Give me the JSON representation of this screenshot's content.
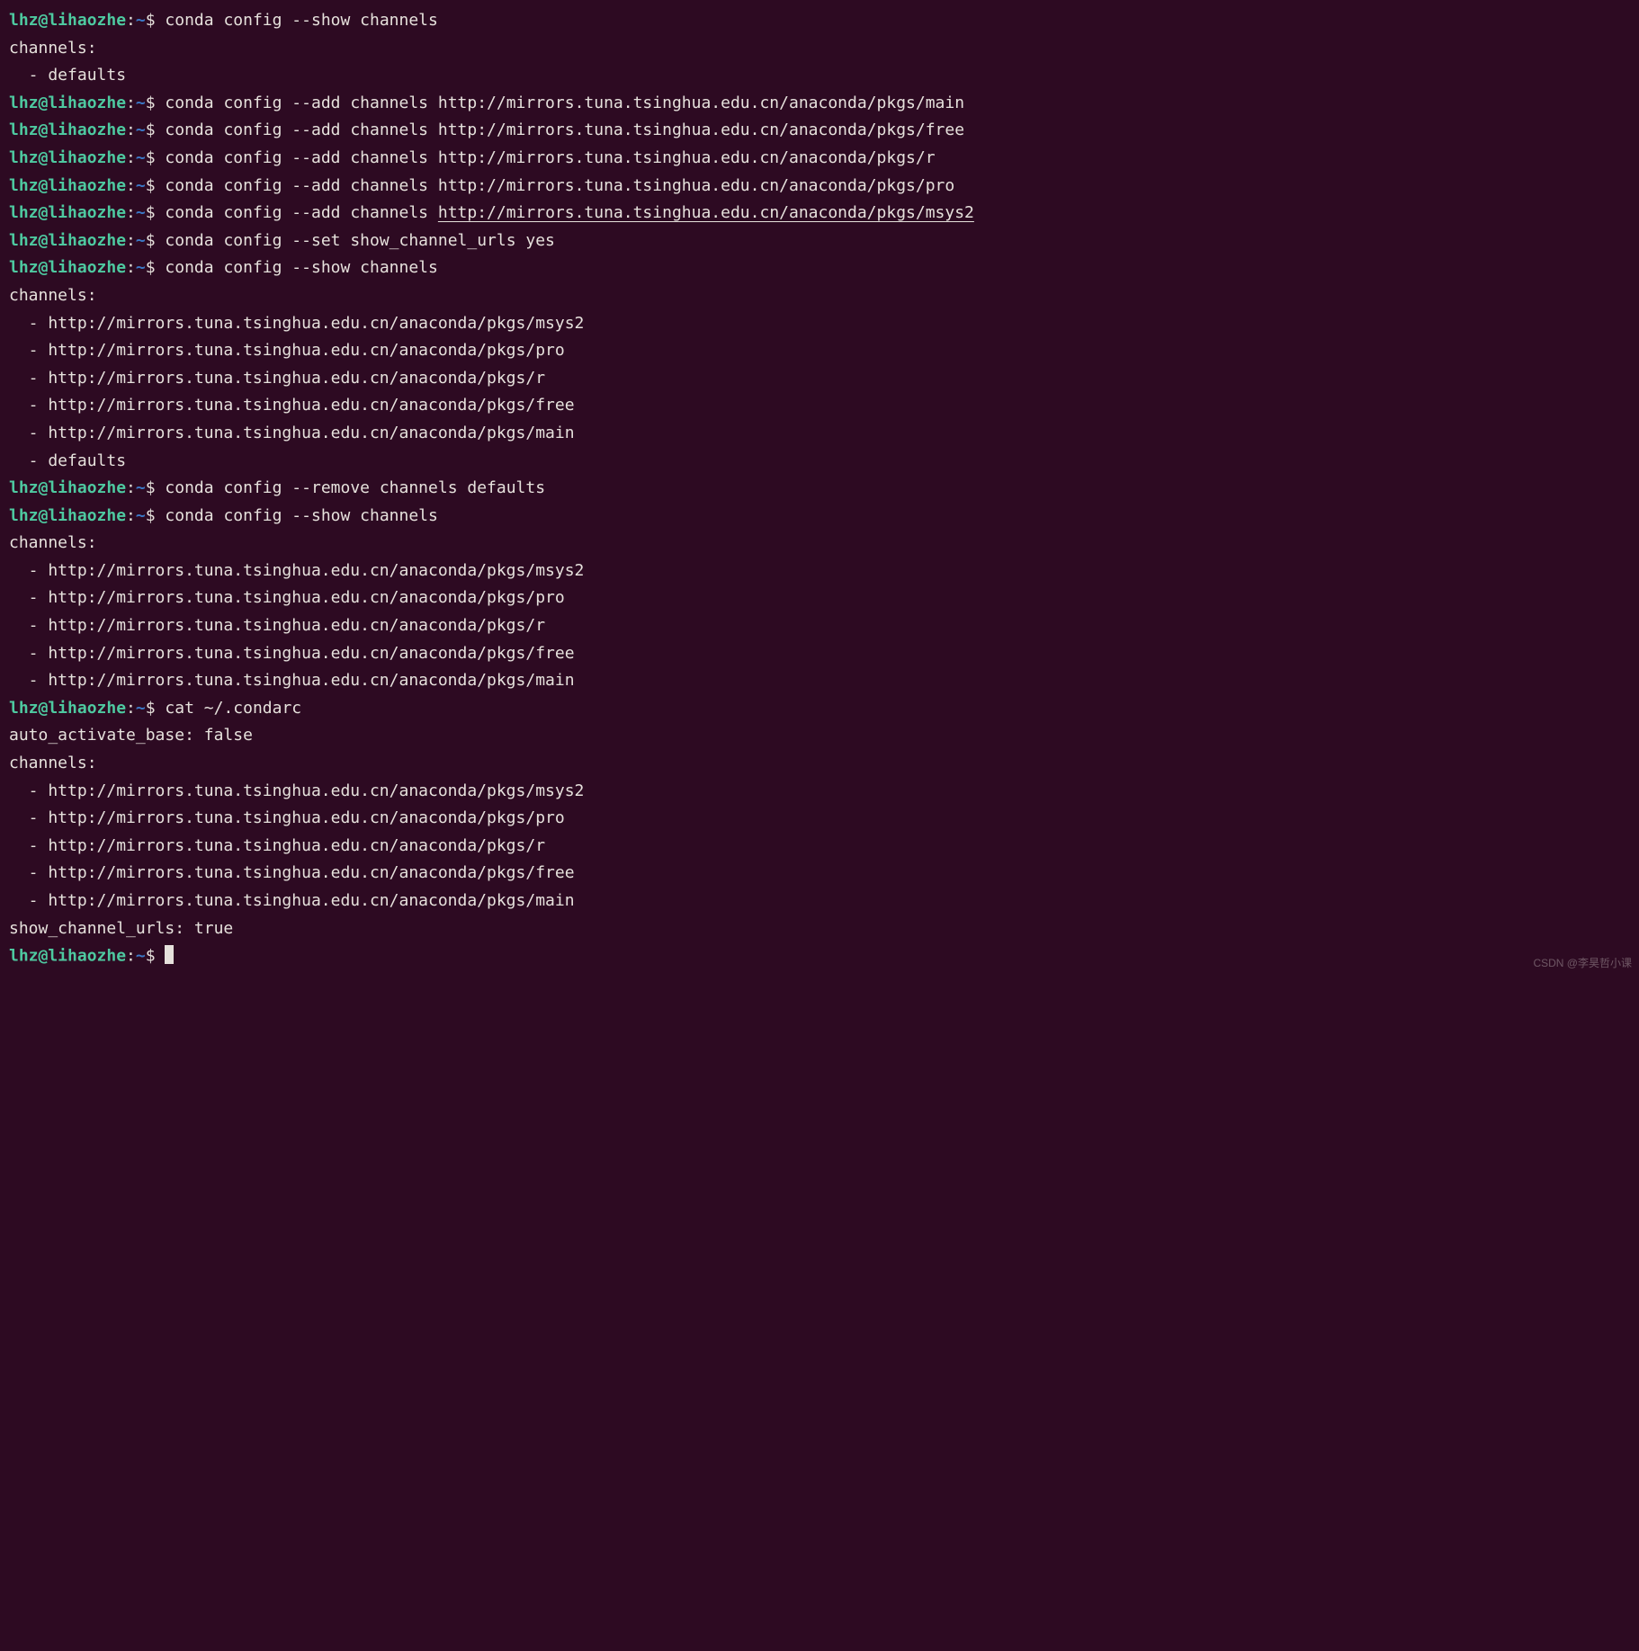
{
  "prompt": {
    "user_host": "lhz@lihaozhe",
    "colon": ":",
    "cwd": "~",
    "dollar": "$"
  },
  "watermark": "CSDN @李昊哲小课",
  "lines": [
    {
      "type": "prompt",
      "cmd_parts": [
        {
          "text": "conda config --show channels"
        }
      ]
    },
    {
      "type": "out",
      "text": "channels:"
    },
    {
      "type": "out",
      "text": "  - defaults"
    },
    {
      "type": "prompt",
      "cmd_parts": [
        {
          "text": "conda config --add channels http://mirrors.tuna.tsinghua.edu.cn/anaconda/pkgs/main"
        }
      ]
    },
    {
      "type": "prompt",
      "cmd_parts": [
        {
          "text": "conda config --add channels http://mirrors.tuna.tsinghua.edu.cn/anaconda/pkgs/free"
        }
      ]
    },
    {
      "type": "prompt",
      "cmd_parts": [
        {
          "text": "conda config --add channels http://mirrors.tuna.tsinghua.edu.cn/anaconda/pkgs/r"
        }
      ]
    },
    {
      "type": "prompt",
      "cmd_parts": [
        {
          "text": "conda config --add channels http://mirrors.tuna.tsinghua.edu.cn/anaconda/pkgs/pro"
        }
      ]
    },
    {
      "type": "prompt",
      "cmd_parts": [
        {
          "text": "conda config --add channels "
        },
        {
          "text": "http://mirrors.tuna.tsinghua.edu.cn/anaconda/pkgs/msys2",
          "underline": true
        }
      ]
    },
    {
      "type": "prompt",
      "cmd_parts": [
        {
          "text": "conda config --set show_channel_urls yes"
        }
      ]
    },
    {
      "type": "prompt",
      "cmd_parts": [
        {
          "text": "conda config --show channels"
        }
      ]
    },
    {
      "type": "out",
      "text": "channels:"
    },
    {
      "type": "out",
      "text": "  - http://mirrors.tuna.tsinghua.edu.cn/anaconda/pkgs/msys2"
    },
    {
      "type": "out",
      "text": "  - http://mirrors.tuna.tsinghua.edu.cn/anaconda/pkgs/pro"
    },
    {
      "type": "out",
      "text": "  - http://mirrors.tuna.tsinghua.edu.cn/anaconda/pkgs/r"
    },
    {
      "type": "out",
      "text": "  - http://mirrors.tuna.tsinghua.edu.cn/anaconda/pkgs/free"
    },
    {
      "type": "out",
      "text": "  - http://mirrors.tuna.tsinghua.edu.cn/anaconda/pkgs/main"
    },
    {
      "type": "out",
      "text": "  - defaults"
    },
    {
      "type": "prompt",
      "cmd_parts": [
        {
          "text": "conda config --remove channels defaults"
        }
      ]
    },
    {
      "type": "prompt",
      "cmd_parts": [
        {
          "text": "conda config --show channels"
        }
      ]
    },
    {
      "type": "out",
      "text": "channels:"
    },
    {
      "type": "out",
      "text": "  - http://mirrors.tuna.tsinghua.edu.cn/anaconda/pkgs/msys2"
    },
    {
      "type": "out",
      "text": "  - http://mirrors.tuna.tsinghua.edu.cn/anaconda/pkgs/pro"
    },
    {
      "type": "out",
      "text": "  - http://mirrors.tuna.tsinghua.edu.cn/anaconda/pkgs/r"
    },
    {
      "type": "out",
      "text": "  - http://mirrors.tuna.tsinghua.edu.cn/anaconda/pkgs/free"
    },
    {
      "type": "out",
      "text": "  - http://mirrors.tuna.tsinghua.edu.cn/anaconda/pkgs/main"
    },
    {
      "type": "prompt",
      "cmd_parts": [
        {
          "text": "cat ~/.condarc"
        }
      ]
    },
    {
      "type": "out",
      "text": "auto_activate_base: false"
    },
    {
      "type": "out",
      "text": "channels:"
    },
    {
      "type": "out",
      "text": "  - http://mirrors.tuna.tsinghua.edu.cn/anaconda/pkgs/msys2"
    },
    {
      "type": "out",
      "text": "  - http://mirrors.tuna.tsinghua.edu.cn/anaconda/pkgs/pro"
    },
    {
      "type": "out",
      "text": "  - http://mirrors.tuna.tsinghua.edu.cn/anaconda/pkgs/r"
    },
    {
      "type": "out",
      "text": "  - http://mirrors.tuna.tsinghua.edu.cn/anaconda/pkgs/free"
    },
    {
      "type": "out",
      "text": "  - http://mirrors.tuna.tsinghua.edu.cn/anaconda/pkgs/main"
    },
    {
      "type": "out",
      "text": "show_channel_urls: true"
    },
    {
      "type": "prompt",
      "cmd_parts": [],
      "cursor": true
    }
  ]
}
